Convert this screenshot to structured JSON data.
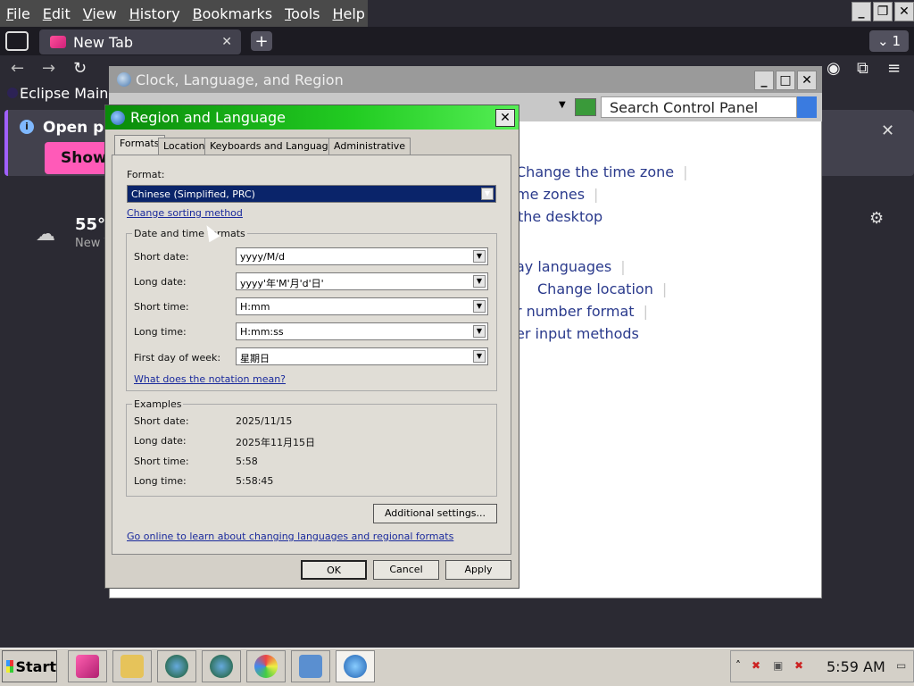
{
  "browser": {
    "menu": [
      "File",
      "Edit",
      "View",
      "History",
      "Bookmarks",
      "Tools",
      "Help"
    ],
    "tab_title": "New Tab",
    "tab_close": "✕",
    "new_tab": "+",
    "tabs_count": "1",
    "bookmark": "Eclipse Main",
    "notification": {
      "text": "Open pre",
      "button": "Show"
    },
    "weather": {
      "temp": "55°F",
      "location": "New Y"
    }
  },
  "control_panel": {
    "title": "Clock, Language, and Region",
    "search_placeholder": "Search Control Panel",
    "links": [
      "Change the time zone",
      "me zones",
      "the desktop",
      "ay languages",
      "Change location",
      "r number format",
      "er input methods"
    ]
  },
  "dialog": {
    "title": "Region and Language",
    "close": "✕",
    "tabs": [
      "Formats",
      "Location",
      "Keyboards and Languages",
      "Administrative"
    ],
    "format_label": "Format:",
    "format_value": "Chinese (Simplified, PRC)",
    "change_sorting": "Change sorting method",
    "datetime_group": "Date and time formats",
    "short_date_label": "Short date:",
    "short_date_value": "yyyy/M/d",
    "long_date_label": "Long date:",
    "long_date_value": "yyyy'年'M'月'd'日'",
    "short_time_label": "Short time:",
    "short_time_value": "H:mm",
    "long_time_label": "Long time:",
    "long_time_value": "H:mm:ss",
    "first_day_label": "First day of week:",
    "first_day_value": "星期日",
    "notation_link": "What does the notation mean?",
    "examples_group": "Examples",
    "ex_short_date": "2025/11/15",
    "ex_long_date": "2025年11月15日",
    "ex_short_time": "5:58",
    "ex_long_time": "5:58:45",
    "additional": "Additional settings...",
    "online_link": "Go online to learn about changing languages and regional formats",
    "ok": "OK",
    "cancel": "Cancel",
    "apply": "Apply"
  },
  "taskbar": {
    "start": "Start",
    "clock": "5:59 AM"
  }
}
